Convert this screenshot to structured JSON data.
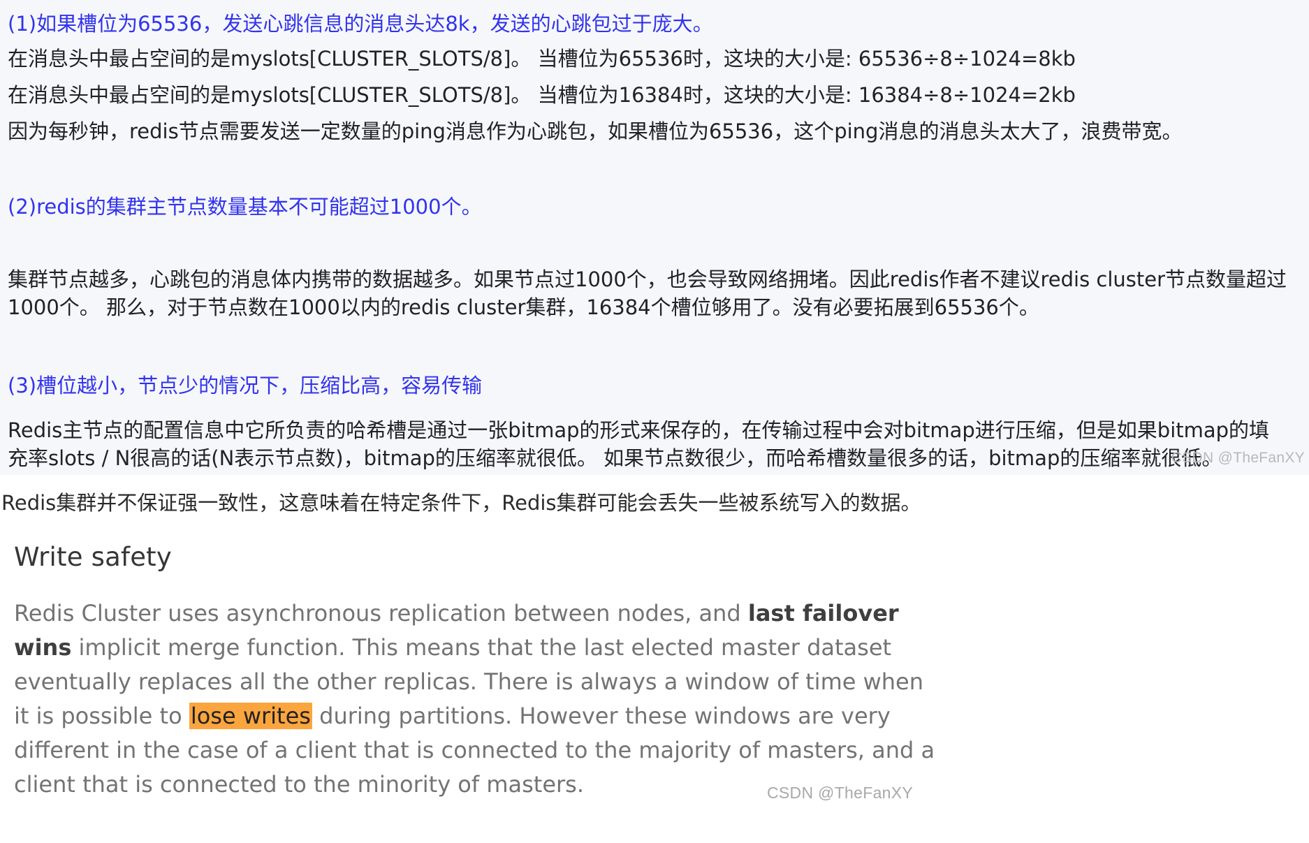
{
  "excerpt1": {
    "p1": "(1)如果槽位为65536，发送心跳信息的消息头达8k，发送的心跳包过于庞大。",
    "p2": "在消息头中最占空间的是myslots[CLUSTER_SLOTS/8]。 当槽位为65536时，这块的大小是: 65536÷8÷1024=8kb",
    "p3": "在消息头中最占空间的是myslots[CLUSTER_SLOTS/8]。 当槽位为16384时，这块的大小是: 16384÷8÷1024=2kb",
    "p4": "因为每秒钟，redis节点需要发送一定数量的ping消息作为心跳包，如果槽位为65536，这个ping消息的消息头太大了，浪费带宽。",
    "p5": "(2)redis的集群主节点数量基本不可能超过1000个。",
    "p6": "集群节点越多，心跳包的消息体内携带的数据越多。如果节点过1000个，也会导致网络拥堵。因此redis作者不建议redis cluster节点数量超过1000个。 那么，对于节点数在1000以内的redis cluster集群，16384个槽位够用了。没有必要拓展到65536个。",
    "p7": "(3)槽位越小，节点少的情况下，压缩比高，容易传输",
    "p8": "Redis主节点的配置信息中它所负责的哈希槽是通过一张bitmap的形式来保存的，在传输过程中会对bitmap进行压缩，但是如果bitmap的填充率slots / N很高的话(N表示节点数)，bitmap的压缩率就很低。 如果节点数很少，而哈希槽数量很多的话，bitmap的压缩率就很低。",
    "watermark": "CSDN @TheFanXY",
    "heading_color": "#3133ee"
  },
  "middle_text": "Redis集群并不保证强一致性，这意味着在特定条件下，Redis集群可能会丢失一些被系统写入的数据。",
  "excerpt2": {
    "heading": "Write safety",
    "s1": "Redis Cluster uses asynchronous replication between nodes, and ",
    "b1": "last failover wins",
    "s2": " implicit merge function. This means that the last elected master dataset eventually replaces all the other replicas. There is always a window of time when it is possible to ",
    "hl": "lose writes",
    "s3": " during partitions. However these windows are very different in the case of a client that is connected to the majority of masters, and a client that is connected to the minority of masters.",
    "watermark": "CSDN @TheFanXY",
    "highlight_color": "#fba53e"
  }
}
